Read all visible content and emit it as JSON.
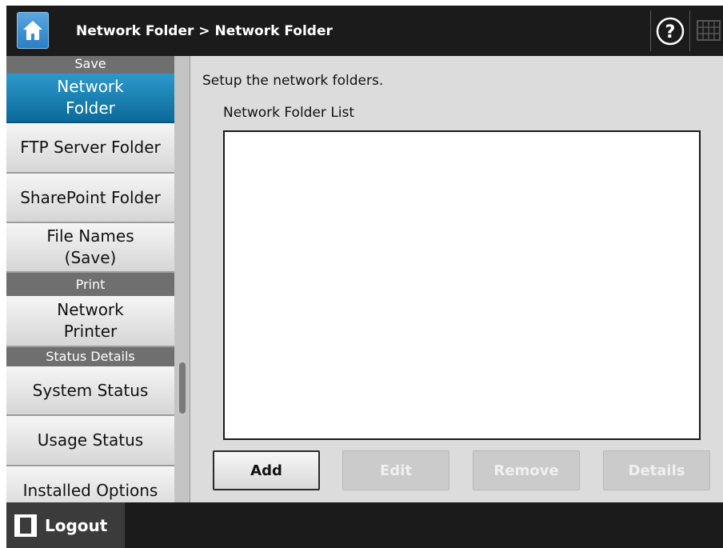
{
  "header": {
    "title": "Network Folder > Network Folder",
    "home_icon": "home-icon",
    "help_icon": "help-icon",
    "keyboard_icon": "keyboard-icon"
  },
  "sidebar": {
    "sections": [
      {
        "label": "Save"
      },
      {
        "label": "Print"
      },
      {
        "label": "Status Details"
      }
    ],
    "items": [
      {
        "label": "Network Folder",
        "active": true
      },
      {
        "label": "FTP Server Folder"
      },
      {
        "label": "SharePoint Folder"
      },
      {
        "label": "File Names (Save)"
      },
      {
        "label": "Network Printer"
      },
      {
        "label": "System Status"
      },
      {
        "label": "Usage Status"
      },
      {
        "label": "Installed Options"
      }
    ]
  },
  "main": {
    "instruction": "Setup the network folders.",
    "list_label": "Network Folder List",
    "list_items": [],
    "buttons": {
      "add": "Add",
      "edit": "Edit",
      "remove": "Remove",
      "details": "Details"
    }
  },
  "footer": {
    "logout_label": "Logout"
  },
  "colors": {
    "active_blue": "#1a84b8",
    "header_bg": "#1b1b1b",
    "section_gray": "#6f6f6f"
  }
}
